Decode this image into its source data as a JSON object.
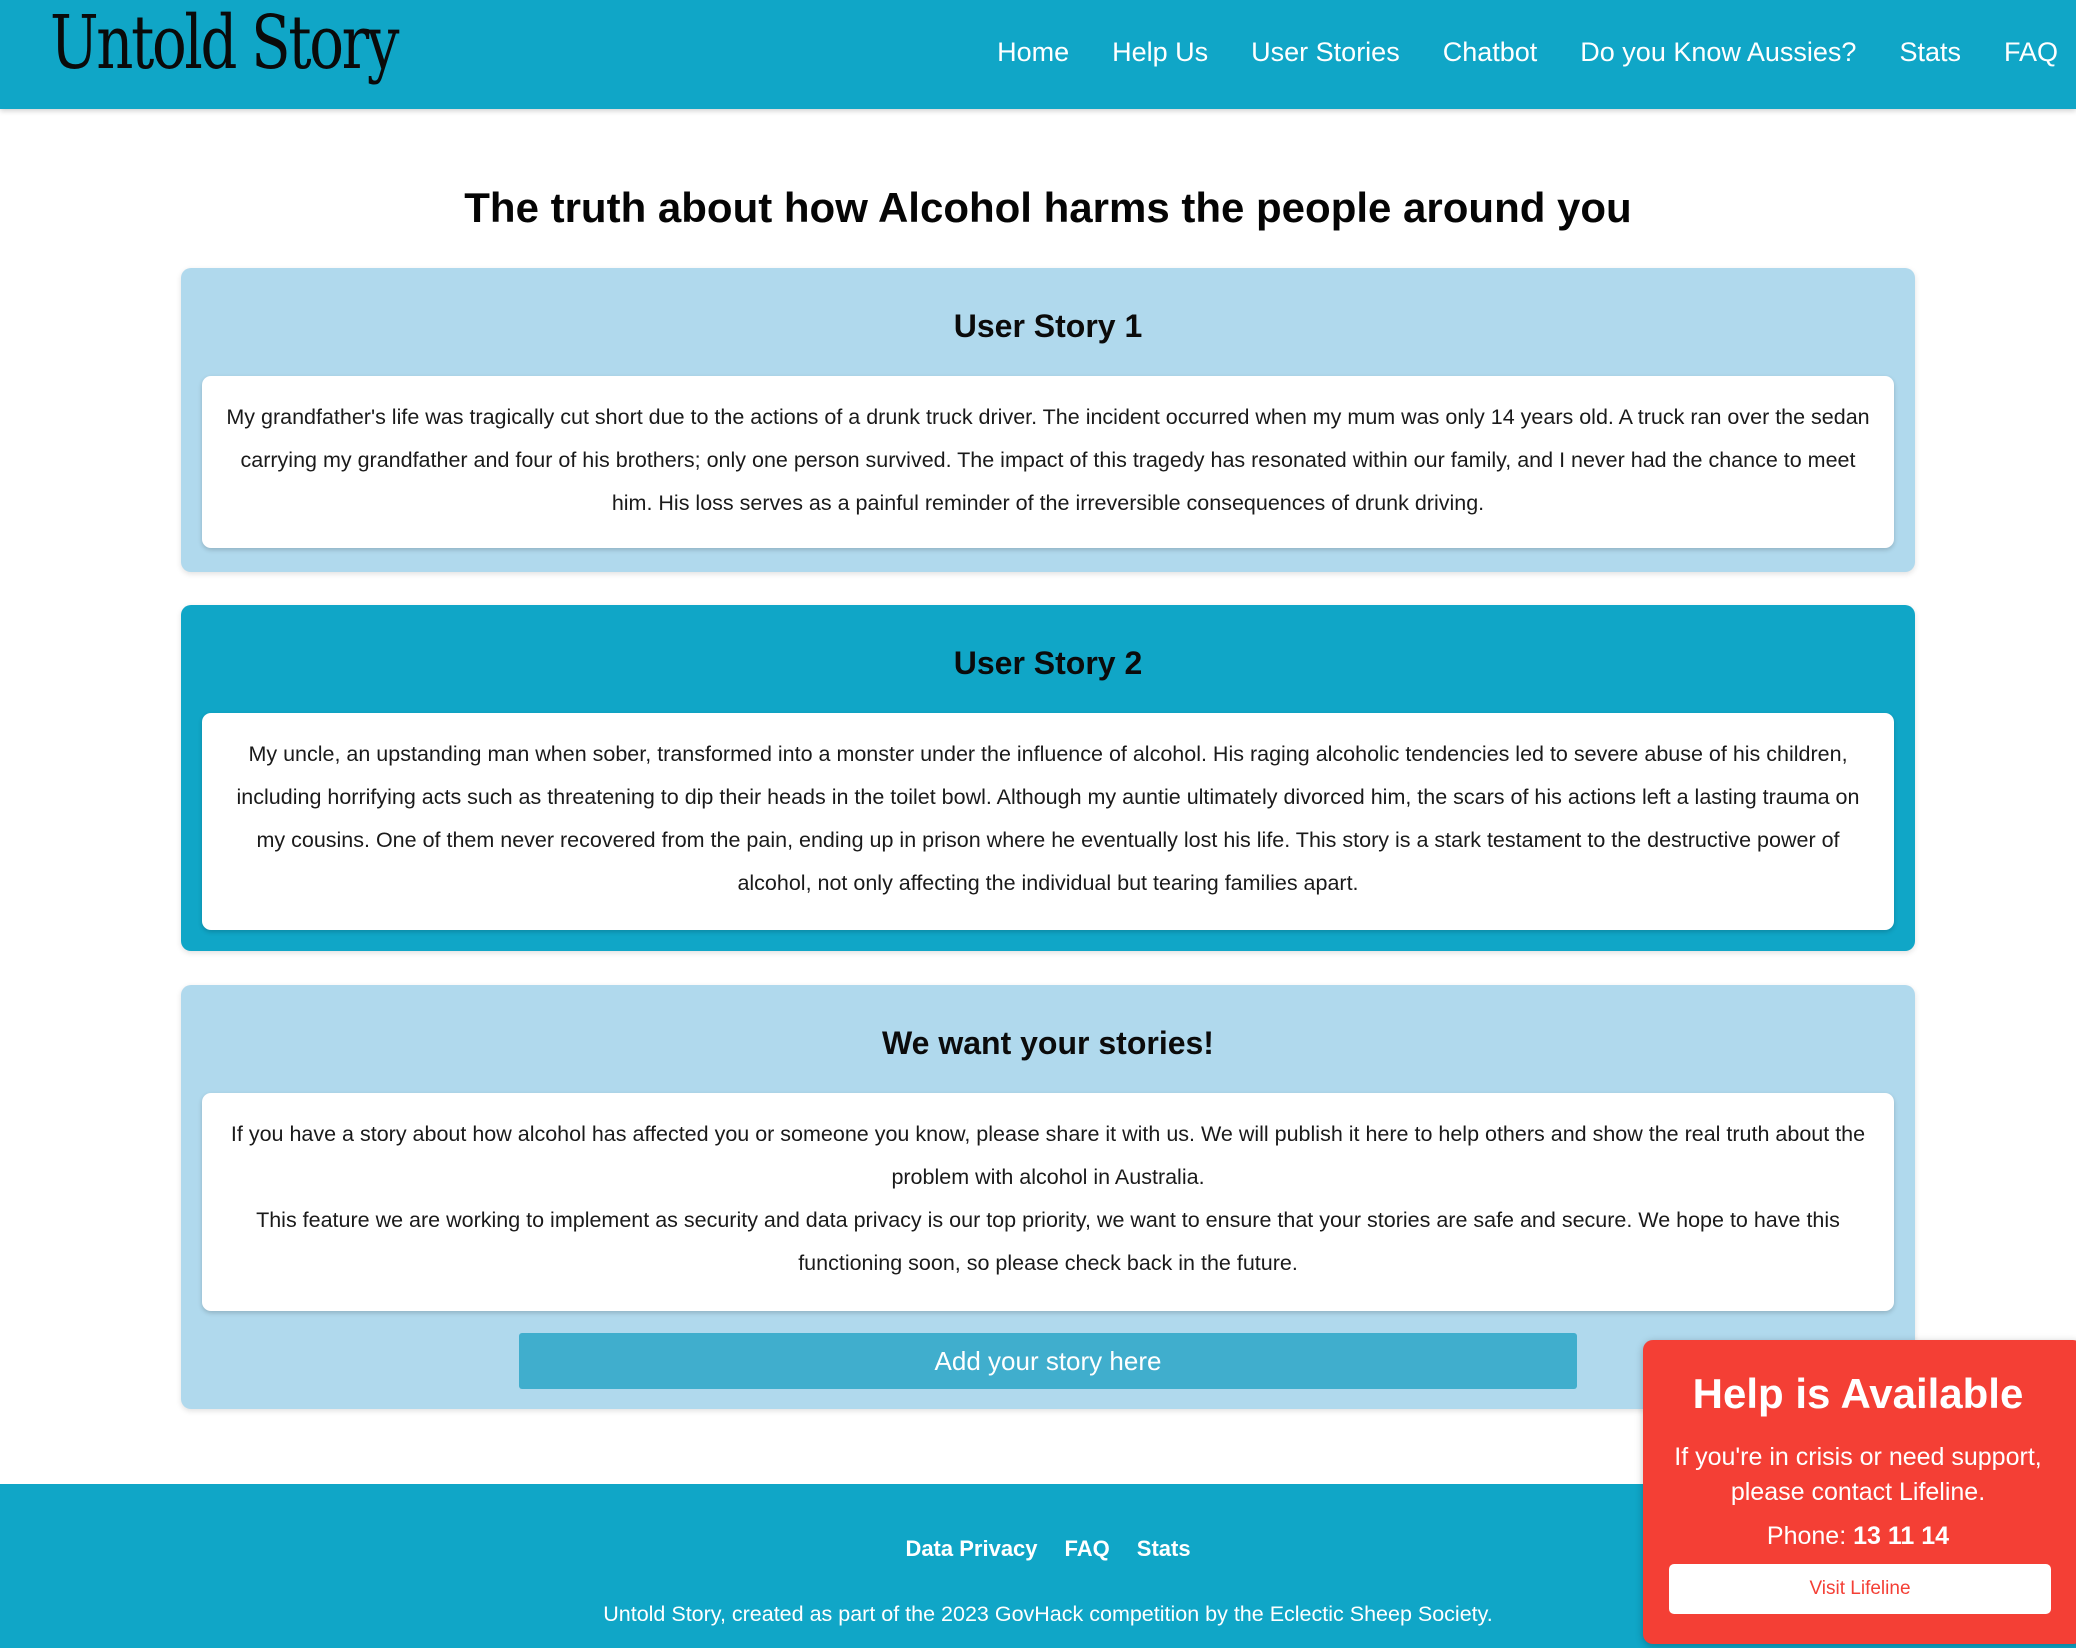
{
  "header": {
    "logo": "Untold Story",
    "nav": [
      "Home",
      "Help Us",
      "User Stories",
      "Chatbot",
      "Do you Know Aussies?",
      "Stats",
      "FAQ"
    ]
  },
  "main": {
    "title": "The truth about how Alcohol harms the people around you",
    "stories": [
      {
        "title": "User Story 1",
        "body": "My grandfather's life was tragically cut short due to the actions of a drunk truck driver. The incident occurred when my mum was only 14 years old. A truck ran over the sedan carrying my grandfather and four of his brothers; only one person survived. The impact of this tragedy has resonated within our family, and I never had the chance to meet him. His loss serves as a painful reminder of the irreversible consequences of drunk driving."
      },
      {
        "title": "User Story 2",
        "body": "My uncle, an upstanding man when sober, transformed into a monster under the influence of alcohol. His raging alcoholic tendencies led to severe abuse of his children, including horrifying acts such as threatening to dip their heads in the toilet bowl. Although my auntie ultimately divorced him, the scars of his actions left a lasting trauma on my cousins. One of them never recovered from the pain, ending up in prison where he eventually lost his life. This story is a stark testament to the destructive power of alcohol, not only affecting the individual but tearing families apart."
      }
    ],
    "call_to_action": {
      "title": "We want your stories!",
      "paragraph1": "If you have a story about how alcohol has affected you or someone you know, please share it with us. We will publish it here to help others and show the real truth about the problem with alcohol in Australia.",
      "paragraph2": "This feature we are working to implement as security and data privacy is our top priority, we want to ensure that your stories are safe and secure. We hope to have this functioning soon, so please check back in the future.",
      "button": "Add your story here"
    }
  },
  "footer": {
    "links": [
      "Data Privacy",
      "FAQ",
      "Stats"
    ],
    "credit": "Untold Story, created as part of the 2023 GovHack competition by the Eclectic Sheep Society."
  },
  "help": {
    "title": "Help is Available",
    "text": "If you're in crisis or need support, please contact Lifeline.",
    "phone_label": "Phone:",
    "phone_number": "13 11 14",
    "button": "Visit Lifeline"
  },
  "colors": {
    "header_bg": "#10a6c7",
    "card_light": "#b0d9ed",
    "card_dark": "#10a6c7",
    "button_bg": "#40aecd",
    "help_bg": "#f43f35"
  }
}
